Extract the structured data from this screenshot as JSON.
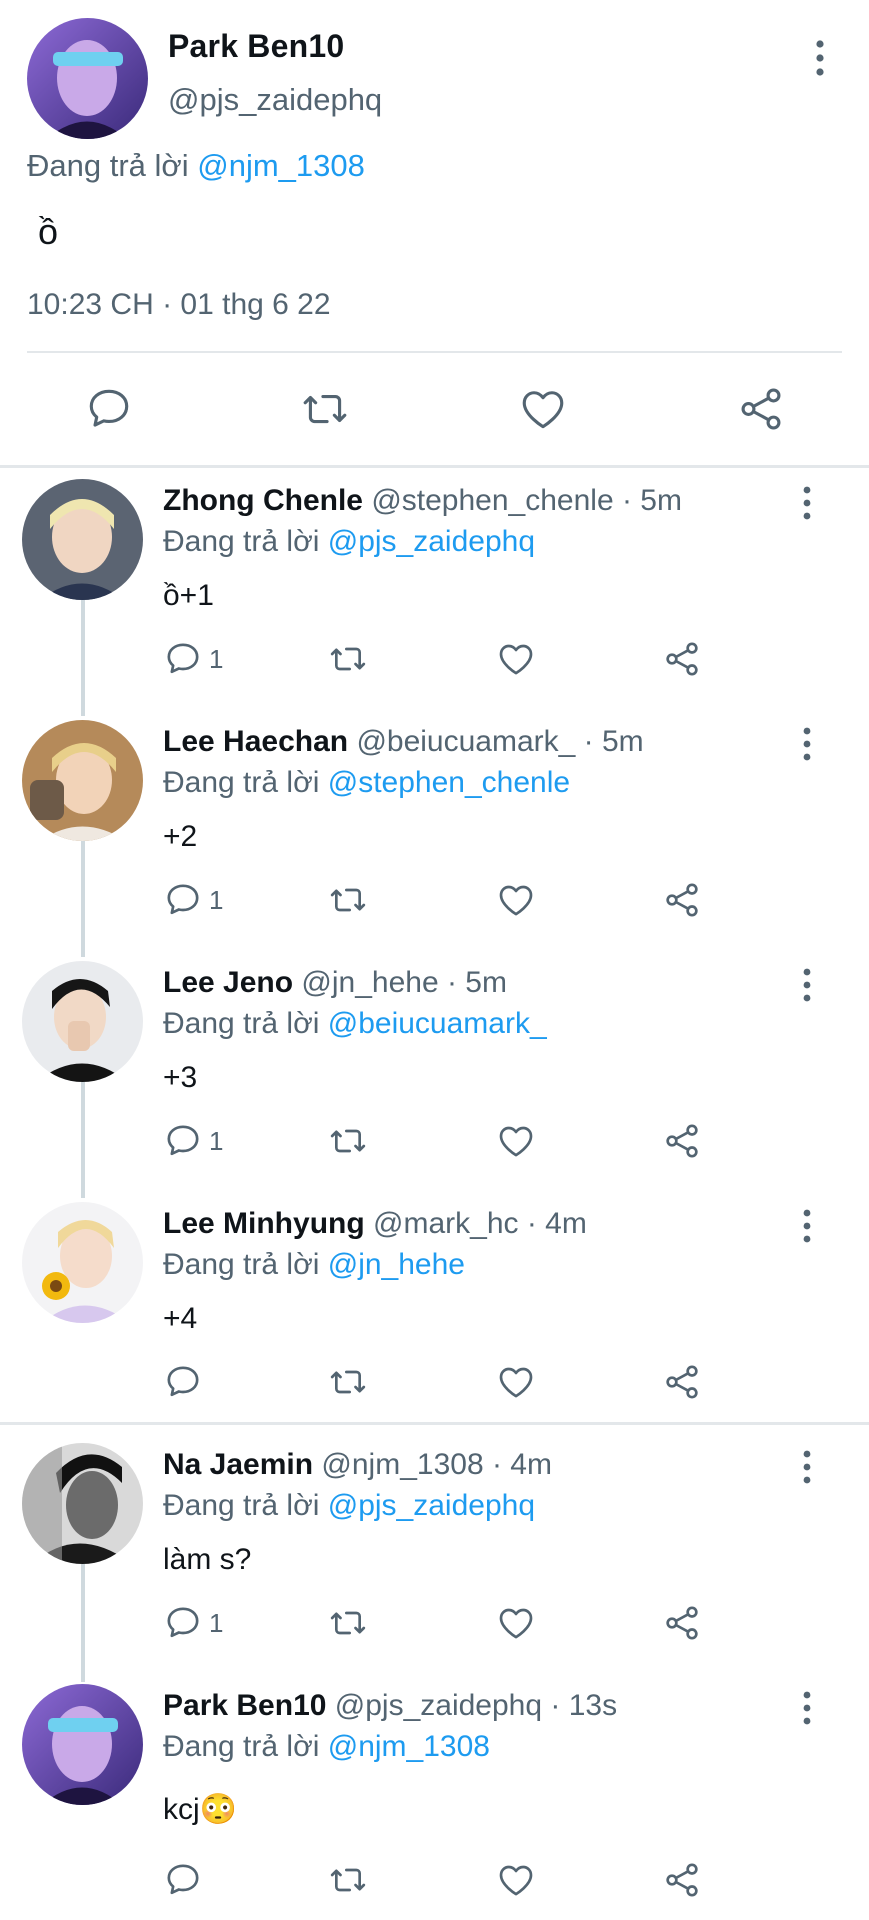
{
  "colors": {
    "accent": "#1d9bf0",
    "secondary_text": "#536471",
    "divider": "#e3e7ea",
    "icon": "#536471"
  },
  "main_tweet": {
    "name": "Park Ben10",
    "handle": "@pjs_zaidephq",
    "replying_prefix": "Đang trả lời",
    "replying_to": "@njm_1308",
    "text": "ồ",
    "timestamp": "10:23 CH · 01 thg 6 22",
    "actions": [
      "reply-icon",
      "retweet-icon",
      "like-icon",
      "share-icon"
    ]
  },
  "replies": [
    {
      "name": "Zhong Chenle",
      "meta": "@stephen_chenle · 5m",
      "replying_prefix": "Đang trả lời",
      "replying_to": "@pjs_zaidephq",
      "text": "ồ+1",
      "reply_count": "1"
    },
    {
      "name": "Lee Haechan",
      "meta": "@beiucuamark_ · 5m",
      "replying_prefix": "Đang trả lời",
      "replying_to": "@stephen_chenle",
      "text": "+2",
      "reply_count": "1"
    },
    {
      "name": "Lee Jeno",
      "meta": "@jn_hehe · 5m",
      "replying_prefix": "Đang trả lời",
      "replying_to": "@beiucuamark_",
      "text": "+3",
      "reply_count": "1"
    },
    {
      "name": "Lee Minhyung",
      "meta": "@mark_hc · 4m",
      "replying_prefix": "Đang trả lời",
      "replying_to": "@jn_hehe",
      "text": "+4",
      "reply_count": ""
    },
    {
      "name": "Na Jaemin",
      "meta": "@njm_1308 · 4m",
      "replying_prefix": "Đang trả lời",
      "replying_to": "@pjs_zaidephq",
      "text": "làm s?",
      "reply_count": "1"
    },
    {
      "name": "Park Ben10",
      "meta": "@pjs_zaidephq · 13s",
      "replying_prefix": "Đang trả lời",
      "replying_to": "@njm_1308",
      "text": "kcj😳",
      "reply_count": ""
    }
  ]
}
